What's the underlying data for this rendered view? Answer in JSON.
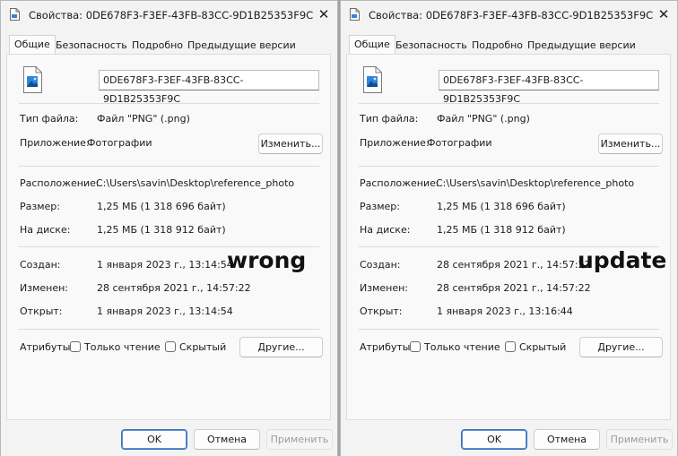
{
  "left": {
    "title": "Свойства: 0DE678F3-F3EF-43FB-83CC-9D1B25353F9C",
    "tabs": [
      "Общие",
      "Безопасность",
      "Подробно",
      "Предыдущие версии"
    ],
    "file_name": "0DE678F3-F3EF-43FB-83CC-9D1B25353F9C",
    "type_label": "Тип файла:",
    "type_value": "Файл \"PNG\" (.png)",
    "app_label": "Приложение:",
    "app_value": "Фотографии",
    "change_button": "Изменить...",
    "location_label": "Расположение:",
    "location_value": "C:\\Users\\savin\\Desktop\\reference_photo",
    "size_label": "Размер:",
    "size_value": "1,25 МБ (1 318 696 байт)",
    "disk_label": "На диске:",
    "disk_value": "1,25 МБ (1 318 912 байт)",
    "created_label": "Создан:",
    "created_value": "1 января 2023 г., 13:14:54",
    "modified_label": "Изменен:",
    "modified_value": "28 сентября 2021 г., 14:57:22",
    "opened_label": "Открыт:",
    "opened_value": "1 января 2023 г., 13:14:54",
    "attributes_label": "Атрибуты:",
    "readonly_label": "Только чтение",
    "hidden_label": "Скрытый",
    "other_button": "Другие...",
    "ok_button": "OK",
    "cancel_button": "Отмена",
    "apply_button": "Применить",
    "overlay_text": "wrong"
  },
  "right": {
    "title": "Свойства: 0DE678F3-F3EF-43FB-83CC-9D1B25353F9C",
    "tabs": [
      "Общие",
      "Безопасность",
      "Подробно",
      "Предыдущие версии"
    ],
    "file_name": "0DE678F3-F3EF-43FB-83CC-9D1B25353F9C",
    "type_label": "Тип файла:",
    "type_value": "Файл \"PNG\" (.png)",
    "app_label": "Приложение:",
    "app_value": "Фотографии",
    "change_button": "Изменить...",
    "location_label": "Расположение:",
    "location_value": "C:\\Users\\savin\\Desktop\\reference_photo",
    "size_label": "Размер:",
    "size_value": "1,25 МБ (1 318 696 байт)",
    "disk_label": "На диске:",
    "disk_value": "1,25 МБ (1 318 912 байт)",
    "created_label": "Создан:",
    "created_value": "28 сентября 2021 г., 14:57:22",
    "modified_label": "Изменен:",
    "modified_value": "28 сентября 2021 г., 14:57:22",
    "opened_label": "Открыт:",
    "opened_value": "1 января 2023 г., 13:16:44",
    "attributes_label": "Атрибуты:",
    "readonly_label": "Только чтение",
    "hidden_label": "Скрытый",
    "other_button": "Другие...",
    "ok_button": "OK",
    "cancel_button": "Отмена",
    "apply_button": "Применить",
    "overlay_text": "update"
  },
  "icons": {
    "title_icon": "document-icon",
    "file_icon": "png-image-file-icon",
    "close_icon": "close-icon"
  },
  "colors": {
    "primary_button_border": "#3b6fb5",
    "file_icon_accent": "#2e86d9"
  }
}
